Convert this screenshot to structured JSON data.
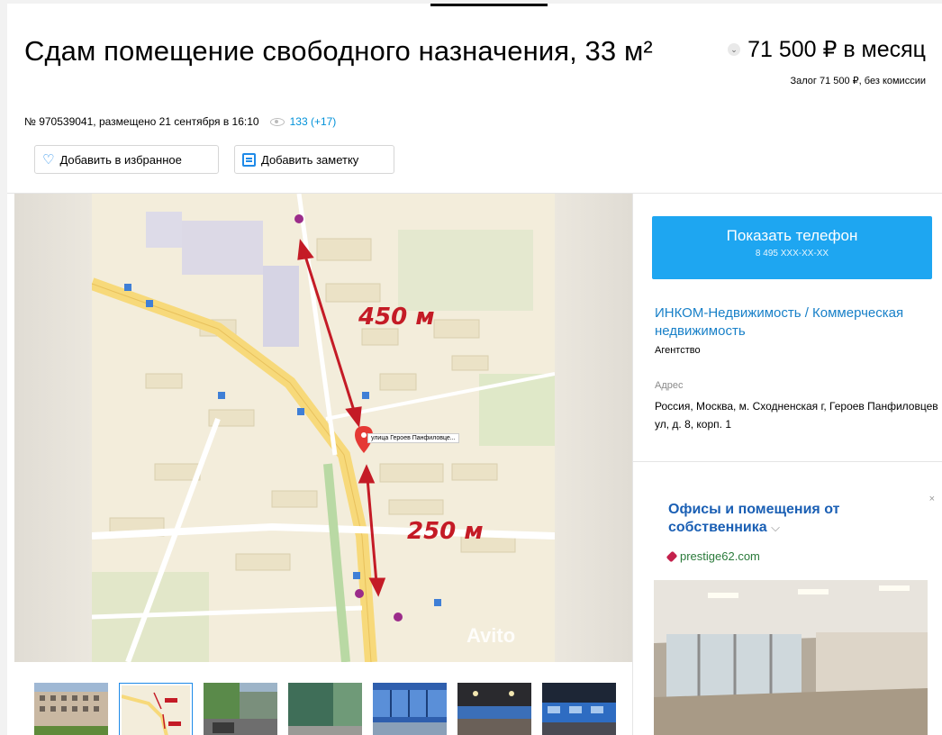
{
  "listing": {
    "title": "Сдам помещение свободного назначения, 33 м²",
    "price": "71 500 ₽ в месяц",
    "deposit": "Залог 71 500 ₽, без комиссии",
    "meta": "№ 970539041, размещено 21 сентября в 16:10",
    "views": "133 (+17)"
  },
  "actions": {
    "favorite": "Добавить в избранное",
    "note": "Добавить заметку"
  },
  "map": {
    "distance_top": "450 м",
    "distance_bottom": "250 м",
    "pin_label": "улица Героев Панфиловце...",
    "watermark": "Avito"
  },
  "thumbnails": [
    {
      "name": "building",
      "active": false
    },
    {
      "name": "map",
      "active": true
    },
    {
      "name": "street",
      "active": false
    },
    {
      "name": "facade",
      "active": false
    },
    {
      "name": "storefront",
      "active": false
    },
    {
      "name": "metro-platform",
      "active": false
    },
    {
      "name": "metro-train",
      "active": false
    }
  ],
  "contact": {
    "phone_button": "Показать телефон",
    "phone_masked": "8 495 XXX-XX-XX",
    "agency_name": "ИНКОМ-Недвижимость / Коммерческая недвижимость",
    "agency_type": "Агентство",
    "address_label": "Адрес",
    "address": "Россия, Москва, м. Сходненская г, Героев Панфиловцев ул, д. 8, корп. 1"
  },
  "ad": {
    "title": "Офисы и помещения от собственника",
    "site": "prestige62.com",
    "close": "×"
  },
  "colors": {
    "accent": "#1ea6f1",
    "link": "#1880c8",
    "distance": "#c41b26"
  }
}
